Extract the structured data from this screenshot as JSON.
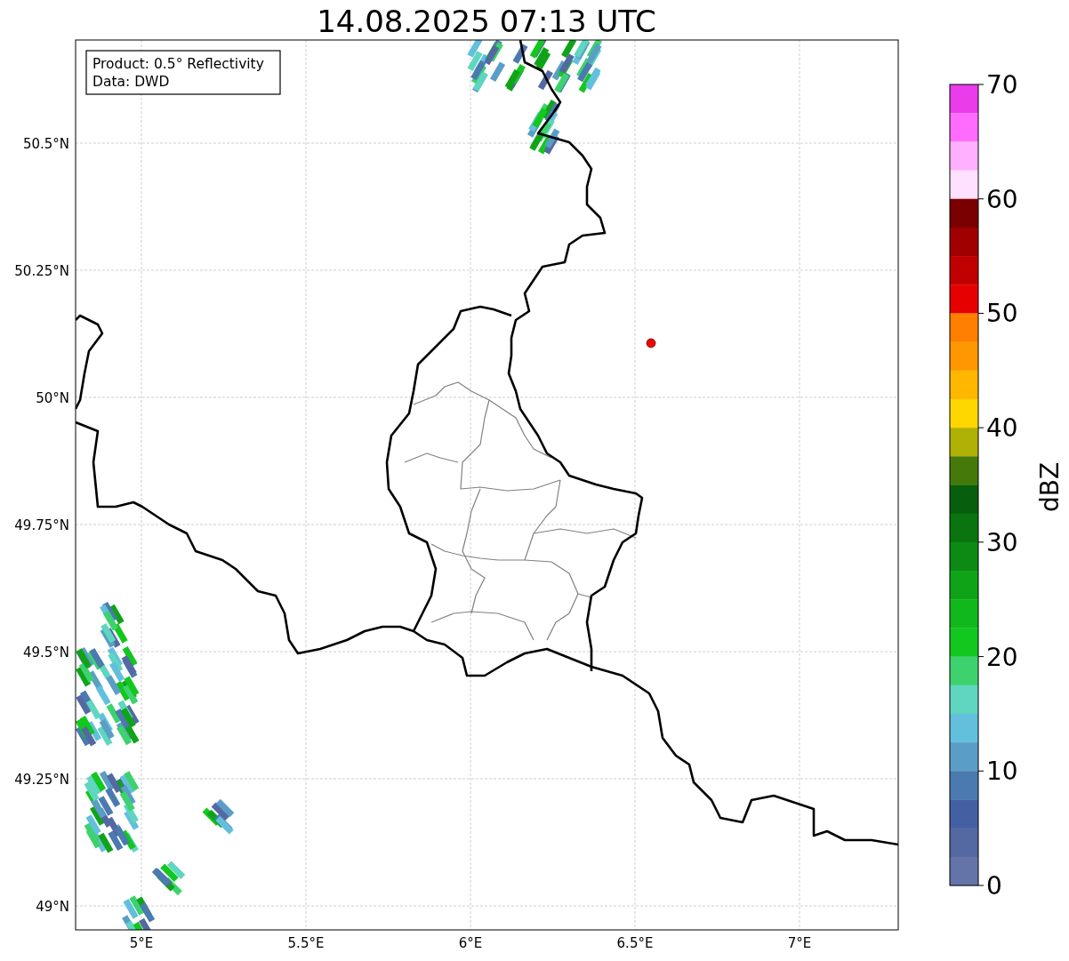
{
  "title": "14.08.2025 07:13 UTC",
  "legend": [
    "Product: 0.5° Reflectivity",
    "Data: DWD"
  ],
  "lat_ticks": [
    "50.5°N",
    "50.25°N",
    "50°N",
    "49.75°N",
    "49.5°N",
    "49.25°N",
    "49°N"
  ],
  "lon_ticks": [
    "5°E",
    "5.5°E",
    "6°E",
    "6.5°E",
    "7°E"
  ],
  "colorbar": {
    "label": "dBZ",
    "ticks": [
      "70",
      "60",
      "50",
      "40",
      "30",
      "20",
      "10",
      "0"
    ],
    "segments": [
      {
        "color": "#ea3ceb"
      },
      {
        "color": "#ff6cff"
      },
      {
        "color": "#ffb0ff"
      },
      {
        "color": "#ffe0ff"
      },
      {
        "color": "#7a0000"
      },
      {
        "color": "#a00000"
      },
      {
        "color": "#c00000"
      },
      {
        "color": "#e60000"
      },
      {
        "color": "#ff7f00"
      },
      {
        "color": "#ff9800"
      },
      {
        "color": "#ffb700"
      },
      {
        "color": "#ffd700"
      },
      {
        "color": "#b0b105"
      },
      {
        "color": "#457a0b"
      },
      {
        "color": "#075f0d"
      },
      {
        "color": "#0a7510"
      },
      {
        "color": "#0c8a14"
      },
      {
        "color": "#0fa418"
      },
      {
        "color": "#10b81b"
      },
      {
        "color": "#12c71e"
      },
      {
        "color": "#3ed26e"
      },
      {
        "color": "#5fd6c0"
      },
      {
        "color": "#62c0dc"
      },
      {
        "color": "#5a9ec6"
      },
      {
        "color": "#4a7ab0"
      },
      {
        "color": "#4560a2"
      },
      {
        "color": "#5469a1"
      },
      {
        "color": "#6474a8"
      }
    ]
  }
}
